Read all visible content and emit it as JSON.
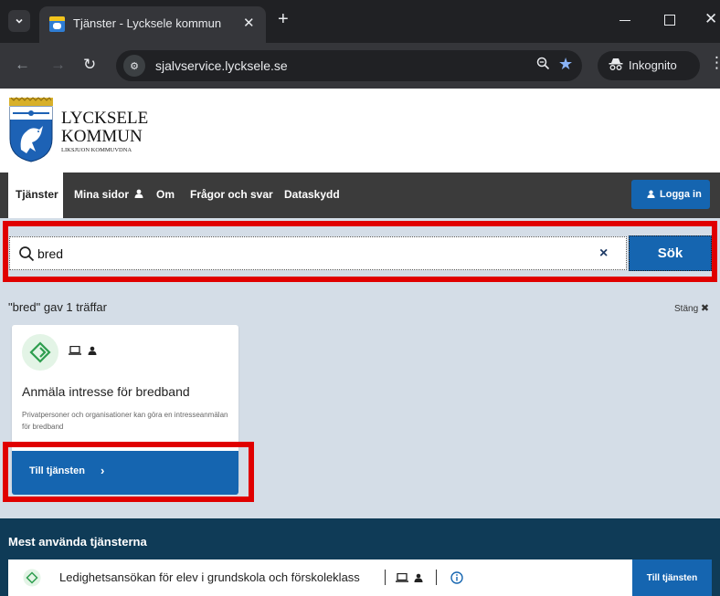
{
  "browser": {
    "tab_title": "Tjänster - Lycksele kommun",
    "url": "sjalvservice.lycksele.se",
    "incognito_label": "Inkognito"
  },
  "logo": {
    "line1": "LYCKSELE",
    "line2": "KOMMUN",
    "subtitle": "LIKSJUON KOMMUVDNA"
  },
  "nav": {
    "items": [
      {
        "label": "Tjänster"
      },
      {
        "label": "Mina sidor"
      },
      {
        "label": "Om"
      },
      {
        "label": "Frågor och svar"
      },
      {
        "label": "Dataskydd"
      }
    ],
    "login_label": "Logga in"
  },
  "search": {
    "value": "bred",
    "clear_symbol": "×",
    "button_label": "Sök"
  },
  "results": {
    "count_text": "\"bred\" gav 1 träffar",
    "close_label": "Stäng",
    "cards": [
      {
        "title": "Anmäla intresse för bredband",
        "description": "Privatpersoner och organisationer kan göra en intresseanmälan för bredband",
        "button_label": "Till tjänsten"
      }
    ]
  },
  "popular": {
    "title": "Mest använda tjänsterna",
    "items": [
      {
        "label": "Ledighetsansökan för elev i grundskola och förskoleklass",
        "button_label": "Till tjänsten"
      }
    ]
  },
  "colors": {
    "primary_blue": "#1565b0",
    "nav_dark": "#3b3b3b",
    "search_band": "#d4dde7",
    "popular_band": "#0f3b57",
    "annotation_red": "#e00000",
    "service_green": "#2e9e4f"
  }
}
